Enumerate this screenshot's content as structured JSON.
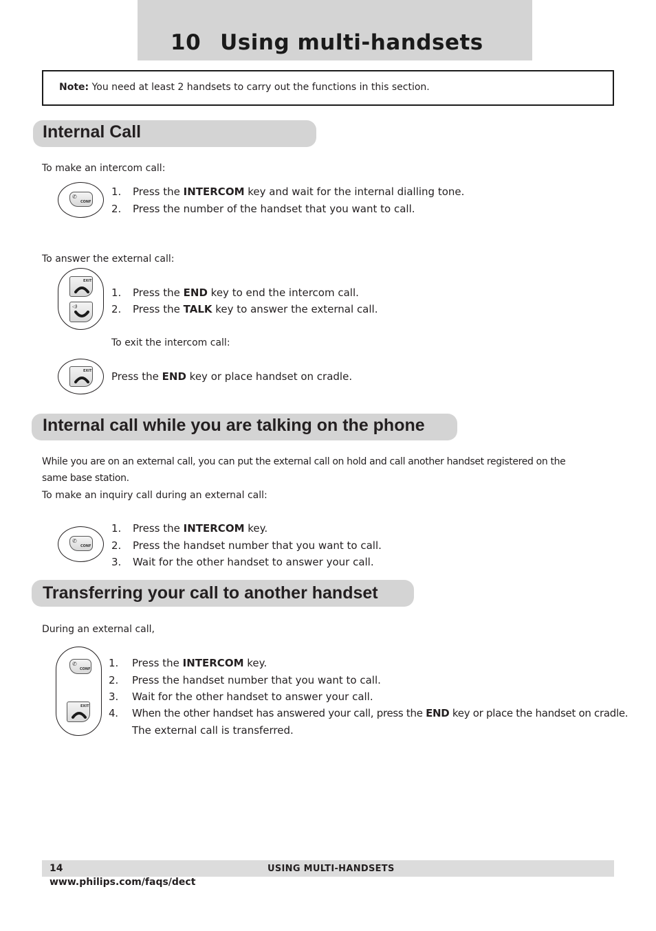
{
  "chapter": {
    "number": "10",
    "title": "Using multi-handsets"
  },
  "note": {
    "label": "Note:",
    "text": " You need at least 2 handsets to carry out the functions in this section."
  },
  "sections": [
    {
      "title": "Internal Call",
      "intro": "To make an intercom call:",
      "steps": [
        {
          "n": "1.",
          "pre": "Press the ",
          "key": "INTERCOM",
          "post": " key and wait for the internal dialling tone."
        },
        {
          "n": "2.",
          "pre": "Press the number of the handset that you want to call.",
          "key": "",
          "post": ""
        }
      ],
      "answer_intro": "To answer the external call:",
      "answer_steps": [
        {
          "n": "1.",
          "pre": "Press the ",
          "key": "END",
          "post": " key to end the intercom call."
        },
        {
          "n": "2.",
          "pre": "Press the ",
          "key": "TALK",
          "post": " key to answer the external call."
        }
      ],
      "exit_intro": "To exit the intercom call:",
      "exit_step": {
        "pre": "Press the ",
        "key": "END",
        "post": " key or place handset on cradle."
      }
    },
    {
      "title": "Internal call while you are talking on the phone",
      "para1": "While you are on an external call, you can put the external call on hold and call another handset registered on the",
      "para2": "same base station.",
      "intro": "To make an inquiry call during an external call:",
      "steps": [
        {
          "n": "1.",
          "pre": "Press the ",
          "key": "INTERCOM",
          "post": " key."
        },
        {
          "n": "2.",
          "pre": "Press the handset number that you want to call.",
          "key": "",
          "post": ""
        },
        {
          "n": "3.",
          "pre": "Wait for the other handset to answer your call.",
          "key": "",
          "post": ""
        }
      ]
    },
    {
      "title": "Transferring your call to another handset",
      "intro": "During an external call,",
      "steps": [
        {
          "n": "1.",
          "pre": "Press the ",
          "key": "INTERCOM",
          "post": " key."
        },
        {
          "n": "2.",
          "pre": "Press the handset number that you want to call.",
          "key": "",
          "post": ""
        },
        {
          "n": "3.",
          "pre": "Wait for the other handset to answer your call.",
          "key": "",
          "post": ""
        },
        {
          "n": "4.",
          "pre": "When the other handset has answered your call, press the ",
          "key": "END",
          "post": " key or place the handset on cradle."
        }
      ],
      "continuation": "The external call is transferred."
    }
  ],
  "key_icons": {
    "intercom_label": "CONF",
    "end_label": "EXIT",
    "intercom_icon": "intercom-key-icon",
    "end_icon": "end-key-icon",
    "talk_icon": "talk-key-icon"
  },
  "footer": {
    "page": "14",
    "title": "USING MULTI-HANDSETS",
    "url": "www.philips.com/faqs/dect"
  }
}
